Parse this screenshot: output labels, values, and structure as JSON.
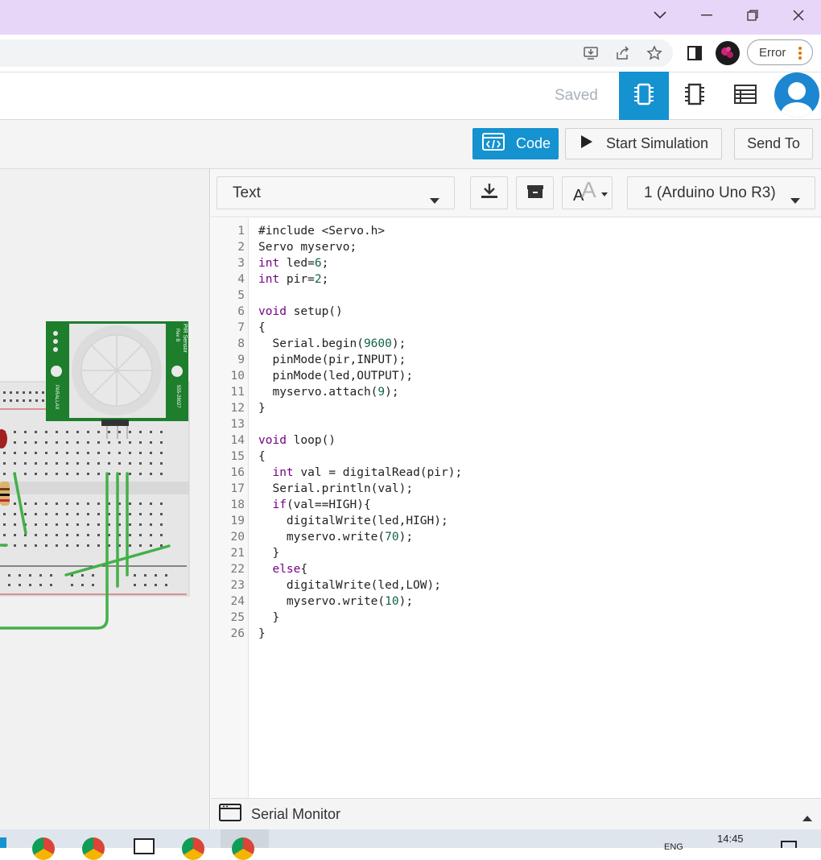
{
  "window": {
    "error_label": "Error"
  },
  "header": {
    "saved_label": "Saved"
  },
  "toolbar": {
    "code_label": "Code",
    "start_sim_label": "Start Simulation",
    "send_to_label": "Send To"
  },
  "editor": {
    "mode_select": "Text",
    "board_select": "1 (Arduino Uno R3)",
    "code_lines": [
      "#include <Servo.h>",
      "Servo myservo;",
      "int led=6;",
      "int pir=2;",
      "",
      "void setup()",
      "{",
      "  Serial.begin(9600);",
      "  pinMode(pir,INPUT);",
      "  pinMode(led,OUTPUT);",
      "  myservo.attach(9);",
      "}",
      "",
      "void loop()",
      "{",
      "  int val = digitalRead(pir);",
      "  Serial.println(val);",
      "  if(val==HIGH){",
      "    digitalWrite(led,HIGH);",
      "    myservo.write(70);",
      "  }",
      "  else{",
      "    digitalWrite(led,LOW);",
      "    myservo.write(10);",
      "  }",
      "}"
    ]
  },
  "serial_monitor": {
    "label": "Serial Monitor"
  },
  "circuit": {
    "pir_title": "PIR Sensor",
    "pir_rev": "Rev B",
    "pir_brand": "PARALLAX",
    "pir_part": "555-28027"
  },
  "taskbar": {
    "time": "14:45",
    "lang": "ENG"
  },
  "colors": {
    "accent": "#1592d0",
    "titlebar": "#e8d6f8",
    "pir_board": "#1d7e2c",
    "wire": "#43b049"
  }
}
